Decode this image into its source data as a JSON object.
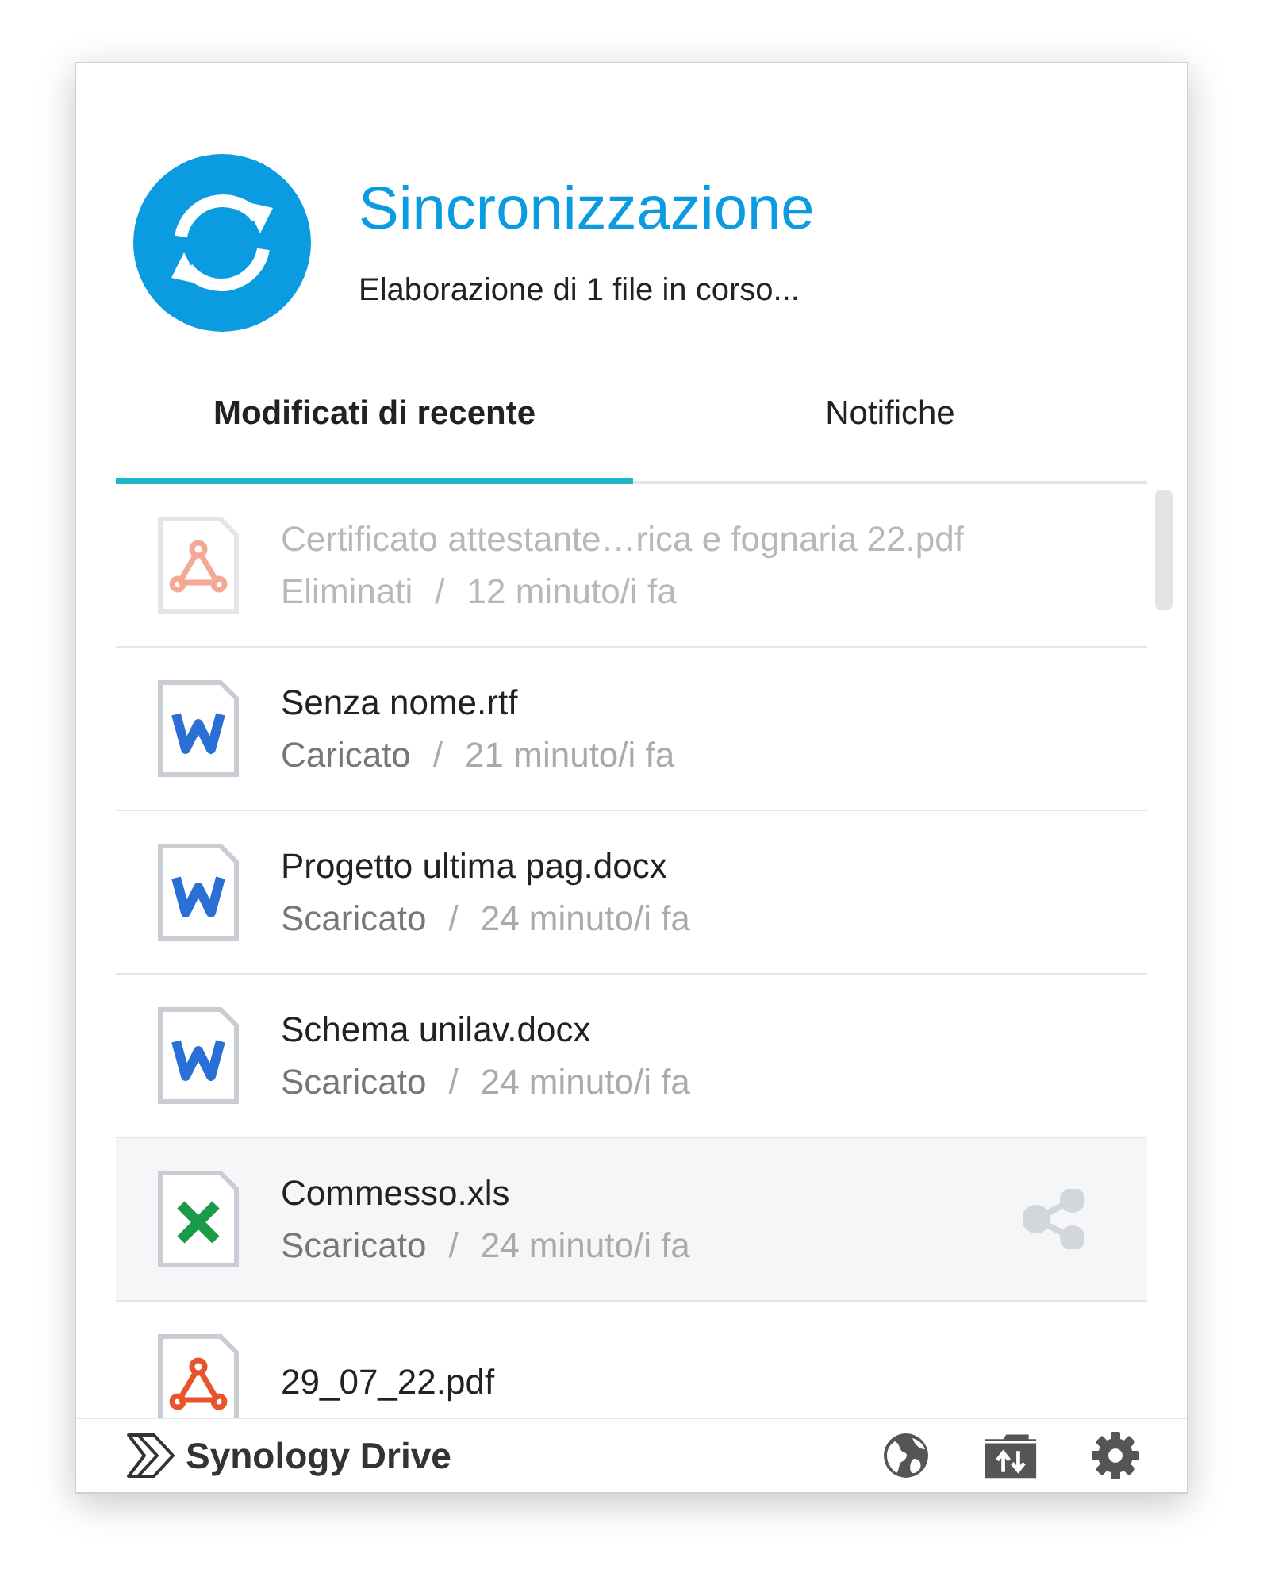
{
  "header": {
    "title": "Sincronizzazione",
    "subtitle": "Elaborazione di 1 file in corso..."
  },
  "tabs": [
    {
      "label": "Modificati di recente",
      "selected": true
    },
    {
      "label": "Notifiche",
      "selected": false
    }
  ],
  "files": [
    {
      "kind": "pdf",
      "name": "Certificato attestante…rica e fognaria 22.pdf",
      "action": "Eliminati",
      "separator": "/",
      "time": "12 minuto/i fa",
      "disabled": true,
      "selected": false
    },
    {
      "kind": "word",
      "name": "Senza nome.rtf",
      "action": "Caricato",
      "separator": "/",
      "time": "21 minuto/i fa",
      "disabled": false,
      "selected": false
    },
    {
      "kind": "word",
      "name": "Progetto ultima pag.docx",
      "action": "Scaricato",
      "separator": "/",
      "time": "24 minuto/i fa",
      "disabled": false,
      "selected": false
    },
    {
      "kind": "word",
      "name": "Schema unilav.docx",
      "action": "Scaricato",
      "separator": "/",
      "time": "24 minuto/i fa",
      "disabled": false,
      "selected": false
    },
    {
      "kind": "excel",
      "name": "Commesso.xls",
      "action": "Scaricato",
      "separator": "/",
      "time": "24 minuto/i fa",
      "disabled": false,
      "selected": true
    },
    {
      "kind": "pdf",
      "name": "29_07_22.pdf",
      "disabled": false,
      "selected": false
    }
  ],
  "footer": {
    "brand": "Synology Drive"
  }
}
